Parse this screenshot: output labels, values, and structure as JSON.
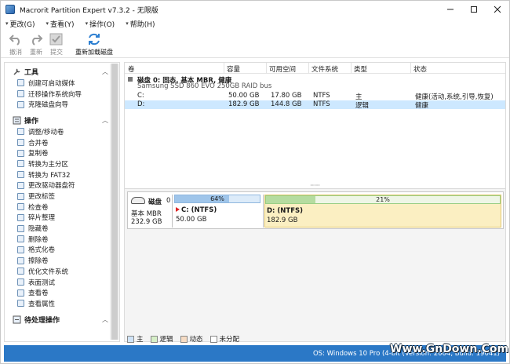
{
  "window": {
    "title": "Macrorit Partition Expert v7.3.2 - 无限版"
  },
  "menu": [
    {
      "label": "更改(G)"
    },
    {
      "label": "查看(Y)"
    },
    {
      "label": "操作(O)"
    },
    {
      "label": "帮助(H)"
    }
  ],
  "toolbar": {
    "undo": "撤消",
    "redo": "重新",
    "commit": "提交",
    "reload": "重新加载磁盘"
  },
  "sidebar": {
    "tools_title": "工具",
    "tools": [
      {
        "label": "创建可启动媒体"
      },
      {
        "label": "迁移操作系统向导"
      },
      {
        "label": "克隆磁盘向导"
      }
    ],
    "ops_title": "操作",
    "ops": [
      {
        "label": "调整/移动卷"
      },
      {
        "label": "合并卷"
      },
      {
        "label": "复制卷"
      },
      {
        "label": "转换为主分区"
      },
      {
        "label": "转换为 FAT32"
      },
      {
        "label": "更改驱动器盘符"
      },
      {
        "label": "更改标签"
      },
      {
        "label": "检查卷"
      },
      {
        "label": "碎片整理"
      },
      {
        "label": "隐藏卷"
      },
      {
        "label": "删除卷"
      },
      {
        "label": "格式化卷"
      },
      {
        "label": "擦除卷"
      },
      {
        "label": "优化文件系统"
      },
      {
        "label": "表面测试"
      },
      {
        "label": "查看卷"
      },
      {
        "label": "查看属性"
      }
    ],
    "pending_title": "待处理操作"
  },
  "table": {
    "headers": [
      "卷",
      "容量",
      "可用空间",
      "文件系统",
      "类型",
      "状态"
    ],
    "disk_label": "磁盘 0: 固态, 基本 MBR, 健康",
    "disk_model": "Samsung SSD 860 EVO 250GB RAID bus",
    "rows": [
      {
        "vol": "C:",
        "cap": "50.00 GB",
        "free": "17.80 GB",
        "fs": "NTFS",
        "type": "主",
        "status": "健康(活动,系统,引导,恢复)"
      },
      {
        "vol": "D:",
        "cap": "182.9 GB",
        "free": "144.8 GB",
        "fs": "NTFS",
        "type": "逻辑",
        "status": "健康"
      }
    ]
  },
  "diskmap": {
    "disk_name": "磁盘",
    "disk_num": "0",
    "disk_type": "基本 MBR",
    "disk_size": "232.9 GB",
    "partitions": [
      {
        "pct_label": "64%",
        "used_fraction": 0.64,
        "name": "C: (NTFS)",
        "size": "50.00 GB"
      },
      {
        "pct_label": "21%",
        "used_fraction": 0.21,
        "name": "D: (NTFS)",
        "size": "182.9 GB"
      }
    ]
  },
  "legend": [
    {
      "label": "主",
      "color": "#cfe3f7"
    },
    {
      "label": "逻辑",
      "color": "#d6efc7"
    },
    {
      "label": "动态",
      "color": "#f6dcc4"
    },
    {
      "label": "未分配",
      "color": "#ffffff"
    }
  ],
  "status": {
    "os": "OS: Windows 10 Pro (4-bit (Version: 2004, Build: 19041)"
  },
  "watermark": "Www.GnDown.Com"
}
